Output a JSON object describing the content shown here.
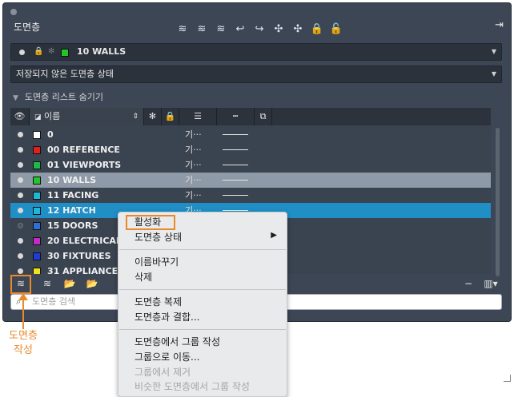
{
  "palette": {
    "title": "도면층",
    "toolbar_icons": [
      "new-layer-icon",
      "new-layer-vp-frozen-icon",
      "delete-layer-icon",
      "set-current-icon",
      "layer-states-icon",
      "layer-isolate-icon",
      "layer-unisolate-icon",
      "layer-lock-icon",
      "layer-unlock-icon"
    ],
    "export_icon": "export-icon"
  },
  "current_layer": {
    "name": "10 WALLS",
    "color": "#22c52a"
  },
  "layer_state": "저장되지 않은 도면층 상태",
  "collapse_label": "도면층 리스트 숨기기",
  "columns": {
    "name": "이름"
  },
  "layers": [
    {
      "name": "0",
      "color": "#ffffff",
      "linetype": "기···",
      "on": true
    },
    {
      "name": "00 REFERENCE",
      "color": "#e02020",
      "linetype": "기···",
      "on": true
    },
    {
      "name": "01 VIEWPORTS",
      "color": "#1fb84b",
      "linetype": "기···",
      "on": true
    },
    {
      "name": "10 WALLS",
      "color": "#22c52a",
      "linetype": "기···",
      "on": true
    },
    {
      "name": "11 FACING",
      "color": "#21b6d6",
      "linetype": "기···",
      "on": true
    },
    {
      "name": "12 HATCH",
      "color": "#21b6d6",
      "linetype": "기···",
      "on": true
    },
    {
      "name": "15 DOORS",
      "color": "#2f6fd6",
      "linetype": "",
      "on": false
    },
    {
      "name": "20 ELECTRICAL",
      "color": "#c02cc4",
      "linetype": "",
      "on": true
    },
    {
      "name": "30 FIXTURES",
      "color": "#1c3dd6",
      "linetype": "",
      "on": true
    },
    {
      "name": "31 APPLIANCES",
      "color": "#f2e21c",
      "linetype": "",
      "on": true
    }
  ],
  "search": {
    "placeholder": "도면층 검색"
  },
  "context_menu": {
    "activate": "활성화",
    "layer_state": "도면층 상태",
    "rename": "이름바꾸기",
    "delete": "삭제",
    "duplicate": "도면층 복제",
    "merge": "도면층과 결합...",
    "group_from_layers": "도면층에서 그룹 작성",
    "move_to_group": "그룹으로 이동...",
    "remove_from_group": "그룹에서 제거",
    "partial": "비슷한 도면층에서 그룹 작성"
  },
  "callout": {
    "line1": "도면층",
    "line2": "작성"
  },
  "accent": "#e88a2c"
}
